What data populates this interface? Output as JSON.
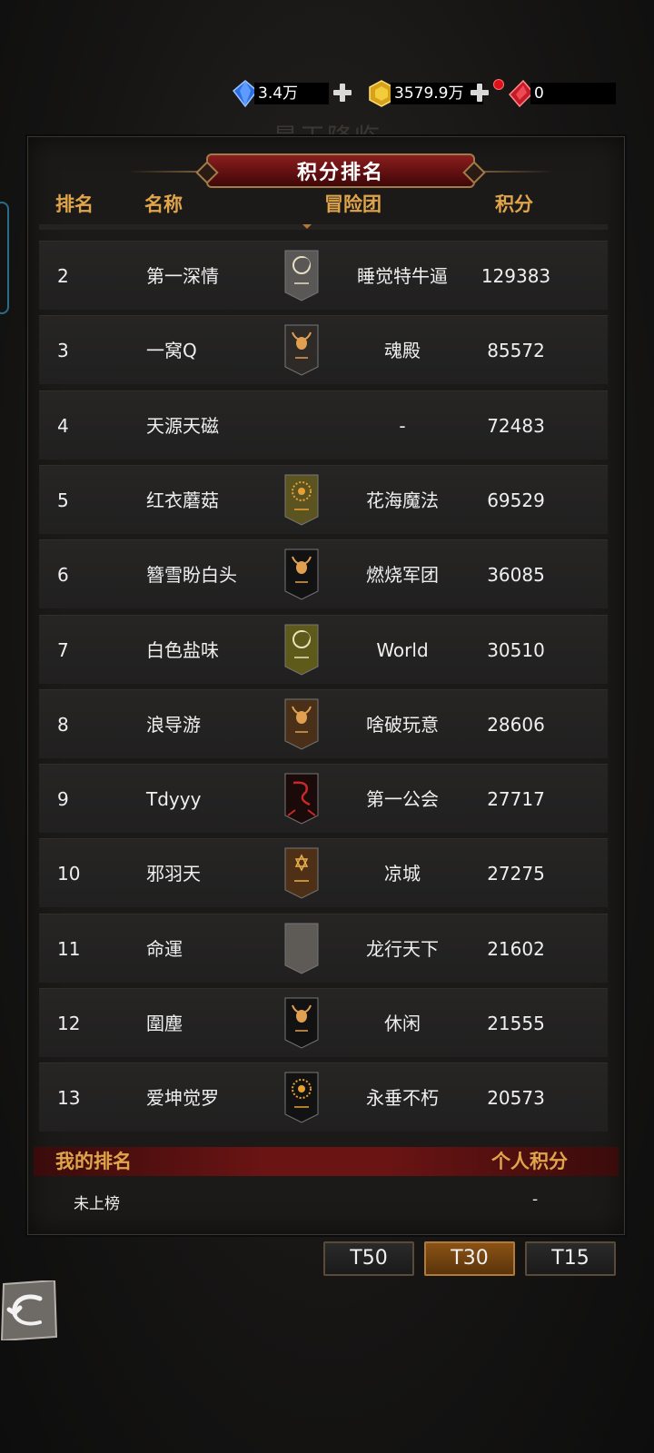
{
  "currency": {
    "diamond": "3.4万",
    "gold": "3579.9万",
    "ruby": "0"
  },
  "background": {
    "ghost_title": "最王降临"
  },
  "panel": {
    "title": "积分排名",
    "columns": {
      "rank": "排名",
      "name": "名称",
      "guild": "冒险团",
      "score": "积分"
    }
  },
  "rows": [
    {
      "rank": "2",
      "name": "第一深情",
      "guild": "睡觉特牛逼",
      "score": "129383",
      "emblem": "moon-emblem",
      "color": "#5a5856"
    },
    {
      "rank": "3",
      "name": "一窝Q",
      "guild": "魂殿",
      "score": "85572",
      "emblem": "bull-skull-emblem",
      "color": "#2e2a28"
    },
    {
      "rank": "4",
      "name": "天源天磁",
      "guild": "-",
      "score": "72483",
      "emblem": "",
      "color": ""
    },
    {
      "rank": "5",
      "name": "红衣蘑菇",
      "guild": "花海魔法",
      "score": "69529",
      "emblem": "sun-eye-emblem",
      "color": "#5c5420"
    },
    {
      "rank": "6",
      "name": "簪雪盼白头",
      "guild": "燃烧军团",
      "score": "36085",
      "emblem": "bull-skull-emblem",
      "color": "#121212"
    },
    {
      "rank": "7",
      "name": "白色盐味",
      "guild": "World",
      "score": "30510",
      "emblem": "moon-emblem",
      "color": "#5d5a1a"
    },
    {
      "rank": "8",
      "name": "浪导游",
      "guild": "啥破玩意",
      "score": "28606",
      "emblem": "bull-skull-emblem",
      "color": "#4a3018"
    },
    {
      "rank": "9",
      "name": "Tdyyy",
      "guild": "第一公会",
      "score": "27717",
      "emblem": "dragon-emblem",
      "color": "#1a0a0a"
    },
    {
      "rank": "10",
      "name": "邪羽天",
      "guild": "凉城",
      "score": "27275",
      "emblem": "star-emblem",
      "color": "#4e3016"
    },
    {
      "rank": "11",
      "name": "命運",
      "guild": "龙行天下",
      "score": "21602",
      "emblem": "blank-emblem",
      "color": "#5e5a56"
    },
    {
      "rank": "12",
      "name": "圍塵",
      "guild": "休闲",
      "score": "21555",
      "emblem": "bull-skull-emblem",
      "color": "#121212"
    },
    {
      "rank": "13",
      "name": "爱坤觉罗",
      "guild": "永垂不朽",
      "score": "20573",
      "emblem": "sun-eye-emblem",
      "color": "#121212"
    }
  ],
  "my_rank": {
    "label": "我的排名",
    "score_label": "个人积分",
    "rank_value": "未上榜",
    "score_value": "-"
  },
  "tabs": [
    {
      "label": "T50",
      "active": false
    },
    {
      "label": "T30",
      "active": true
    },
    {
      "label": "T15",
      "active": false
    }
  ],
  "colors": {
    "accent": "#e0a54a",
    "banner": "#6b1414",
    "active_tab": "#8a5215"
  }
}
